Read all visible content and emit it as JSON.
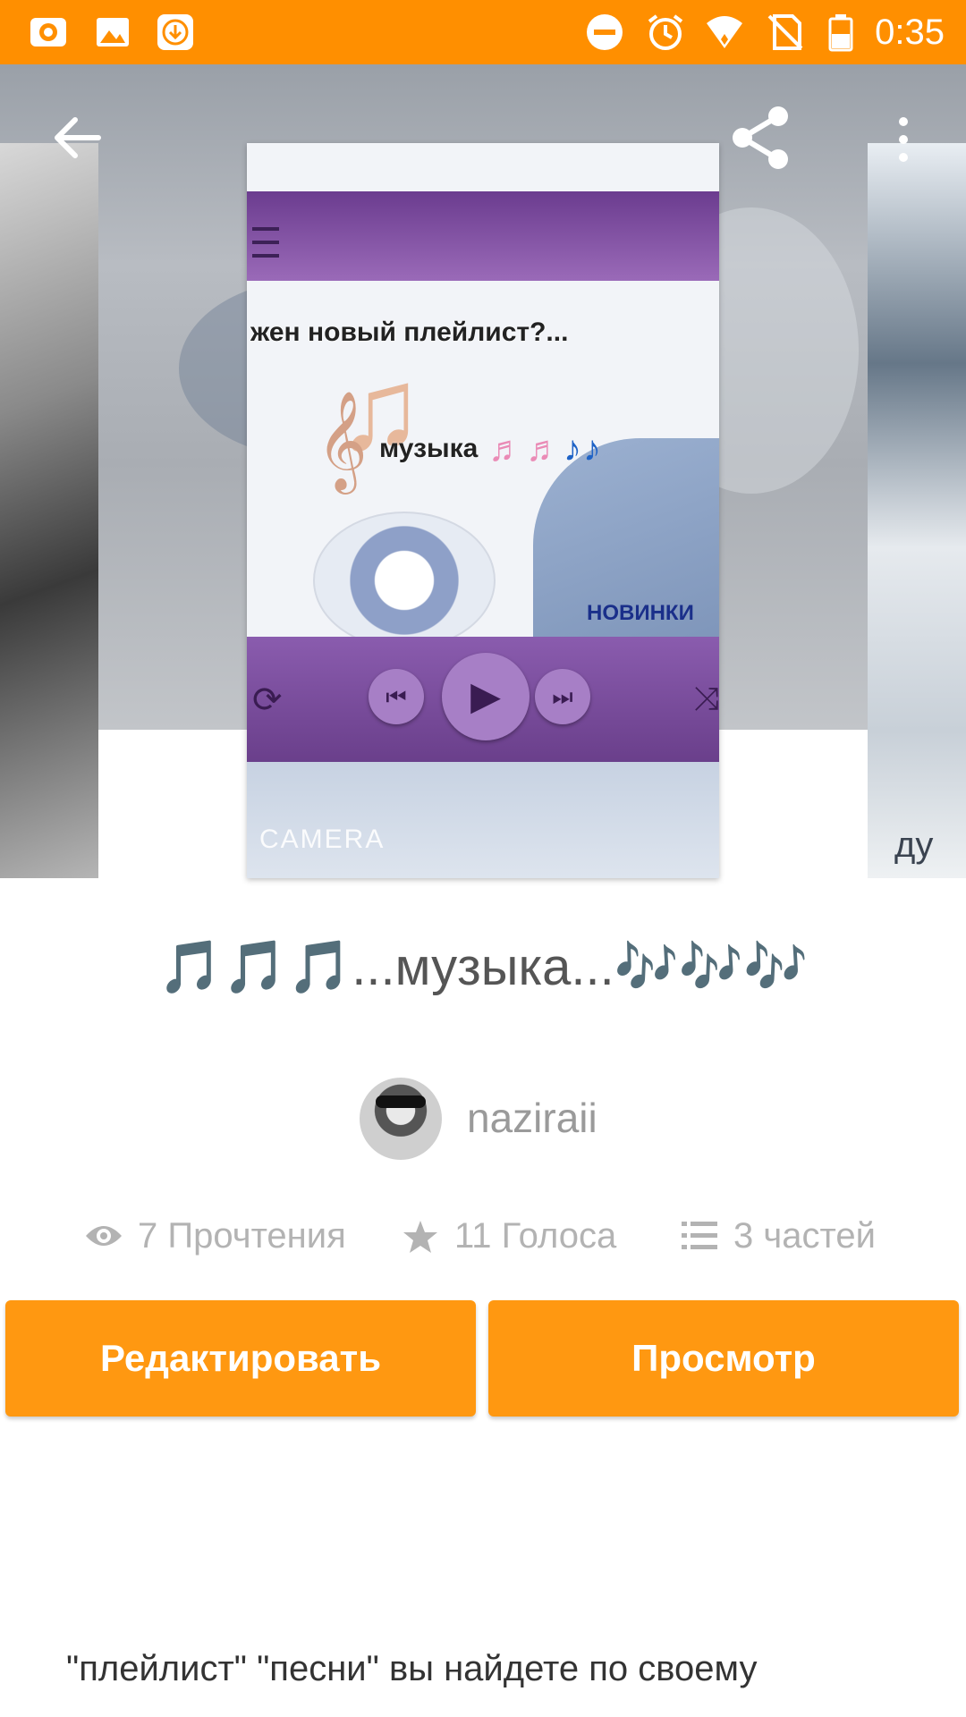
{
  "status_bar": {
    "time": "0:35",
    "left_icons": [
      "camera-app-icon",
      "image-icon",
      "download-icon"
    ],
    "right_icons": [
      "do-not-disturb-icon",
      "alarm-icon",
      "wifi-icon",
      "no-sim-icon",
      "battery-icon"
    ]
  },
  "toolbar": {
    "icons": [
      "back-arrow-icon",
      "share-icon",
      "more-vertical-icon"
    ]
  },
  "cover": {
    "headline": "жен новый плейлист?...",
    "title_text": "музыка",
    "tag": "НОВИНКИ",
    "watermark": "CAMERA",
    "right_cover_text": "ду"
  },
  "story": {
    "title_notes_left": "🎵🎵🎵",
    "title_text": "...музыка...",
    "title_notes_right": "🎶🎶🎶",
    "author": "naziraii"
  },
  "stats": {
    "reads": "7 Прочтения",
    "votes": "11 Голоса",
    "parts": "3 частей"
  },
  "actions": {
    "edit_label": "Редактировать",
    "view_label": "Просмотр"
  },
  "description": {
    "text": "\"плейлист\" \"песни\" вы найдете по своему"
  },
  "colors": {
    "accent": "#ff9811",
    "status_bar": "#ff8f00",
    "stat_text": "#b3b3b3"
  }
}
